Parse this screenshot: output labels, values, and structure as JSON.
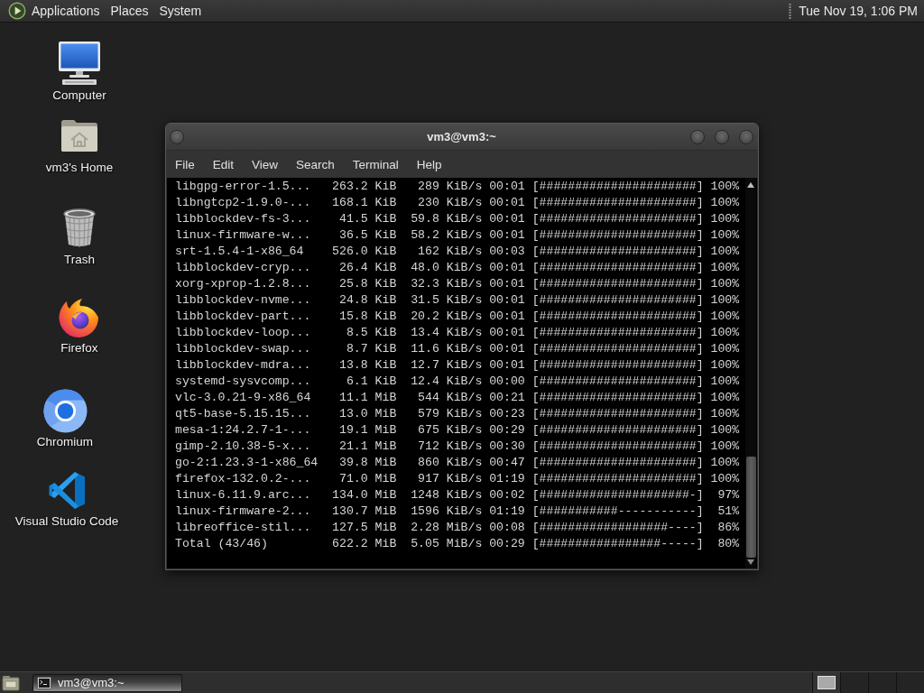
{
  "top_panel": {
    "menus": [
      "Applications",
      "Places",
      "System"
    ],
    "clock": "Tue Nov 19, 1:06 PM"
  },
  "desktop_icons": [
    {
      "kind": "computer",
      "label": "Computer"
    },
    {
      "kind": "home",
      "label": "vm3's Home"
    },
    {
      "kind": "trash",
      "label": "Trash"
    },
    {
      "kind": "firefox",
      "label": "Firefox"
    },
    {
      "kind": "chromium",
      "label": "Chromium"
    },
    {
      "kind": "vscode",
      "label": "Visual Studio Code"
    }
  ],
  "terminal": {
    "title": "vm3@vm3:~",
    "menu": [
      "File",
      "Edit",
      "View",
      "Search",
      "Terminal",
      "Help"
    ],
    "lines": [
      "libgpg-error-1.5...   263.2 KiB   289 KiB/s 00:01 [######################] 100%",
      "libngtcp2-1.9.0-...   168.1 KiB   230 KiB/s 00:01 [######################] 100%",
      "libblockdev-fs-3...    41.5 KiB  59.8 KiB/s 00:01 [######################] 100%",
      "linux-firmware-w...    36.5 KiB  58.2 KiB/s 00:01 [######################] 100%",
      "srt-1.5.4-1-x86_64    526.0 KiB   162 KiB/s 00:03 [######################] 100%",
      "libblockdev-cryp...    26.4 KiB  48.0 KiB/s 00:01 [######################] 100%",
      "xorg-xprop-1.2.8...    25.8 KiB  32.3 KiB/s 00:01 [######################] 100%",
      "libblockdev-nvme...    24.8 KiB  31.5 KiB/s 00:01 [######################] 100%",
      "libblockdev-part...    15.8 KiB  20.2 KiB/s 00:01 [######################] 100%",
      "libblockdev-loop...     8.5 KiB  13.4 KiB/s 00:01 [######################] 100%",
      "libblockdev-swap...     8.7 KiB  11.6 KiB/s 00:01 [######################] 100%",
      "libblockdev-mdra...    13.8 KiB  12.7 KiB/s 00:01 [######################] 100%",
      "systemd-sysvcomp...     6.1 KiB  12.4 KiB/s 00:00 [######################] 100%",
      "vlc-3.0.21-9-x86_64    11.1 MiB   544 KiB/s 00:21 [######################] 100%",
      "qt5-base-5.15.15...    13.0 MiB   579 KiB/s 00:23 [######################] 100%",
      "mesa-1:24.2.7-1-...    19.1 MiB   675 KiB/s 00:29 [######################] 100%",
      "gimp-2.10.38-5-x...    21.1 MiB   712 KiB/s 00:30 [######################] 100%",
      "go-2:1.23.3-1-x86_64   39.8 MiB   860 KiB/s 00:47 [######################] 100%",
      "firefox-132.0.2-...    71.0 MiB   917 KiB/s 01:19 [######################] 100%",
      "linux-6.11.9.arc...   134.0 MiB  1248 KiB/s 00:02 [#####################-]  97%",
      "linux-firmware-2...   130.7 MiB  1596 KiB/s 01:19 [###########-----------]  51%",
      "libreoffice-stil...   127.5 MiB  2.28 MiB/s 00:08 [##################----]  86%",
      "Total (43/46)         622.2 MiB  5.05 MiB/s 00:29 [#################-----]  80%"
    ]
  },
  "taskbar": {
    "tasks": [
      {
        "label": "vm3@vm3:~",
        "selected": true
      }
    ],
    "workspaces": [
      {
        "selected": true,
        "has_window": true
      },
      {
        "selected": false,
        "has_window": false
      },
      {
        "selected": false,
        "has_window": false
      },
      {
        "selected": false,
        "has_window": false
      }
    ]
  }
}
